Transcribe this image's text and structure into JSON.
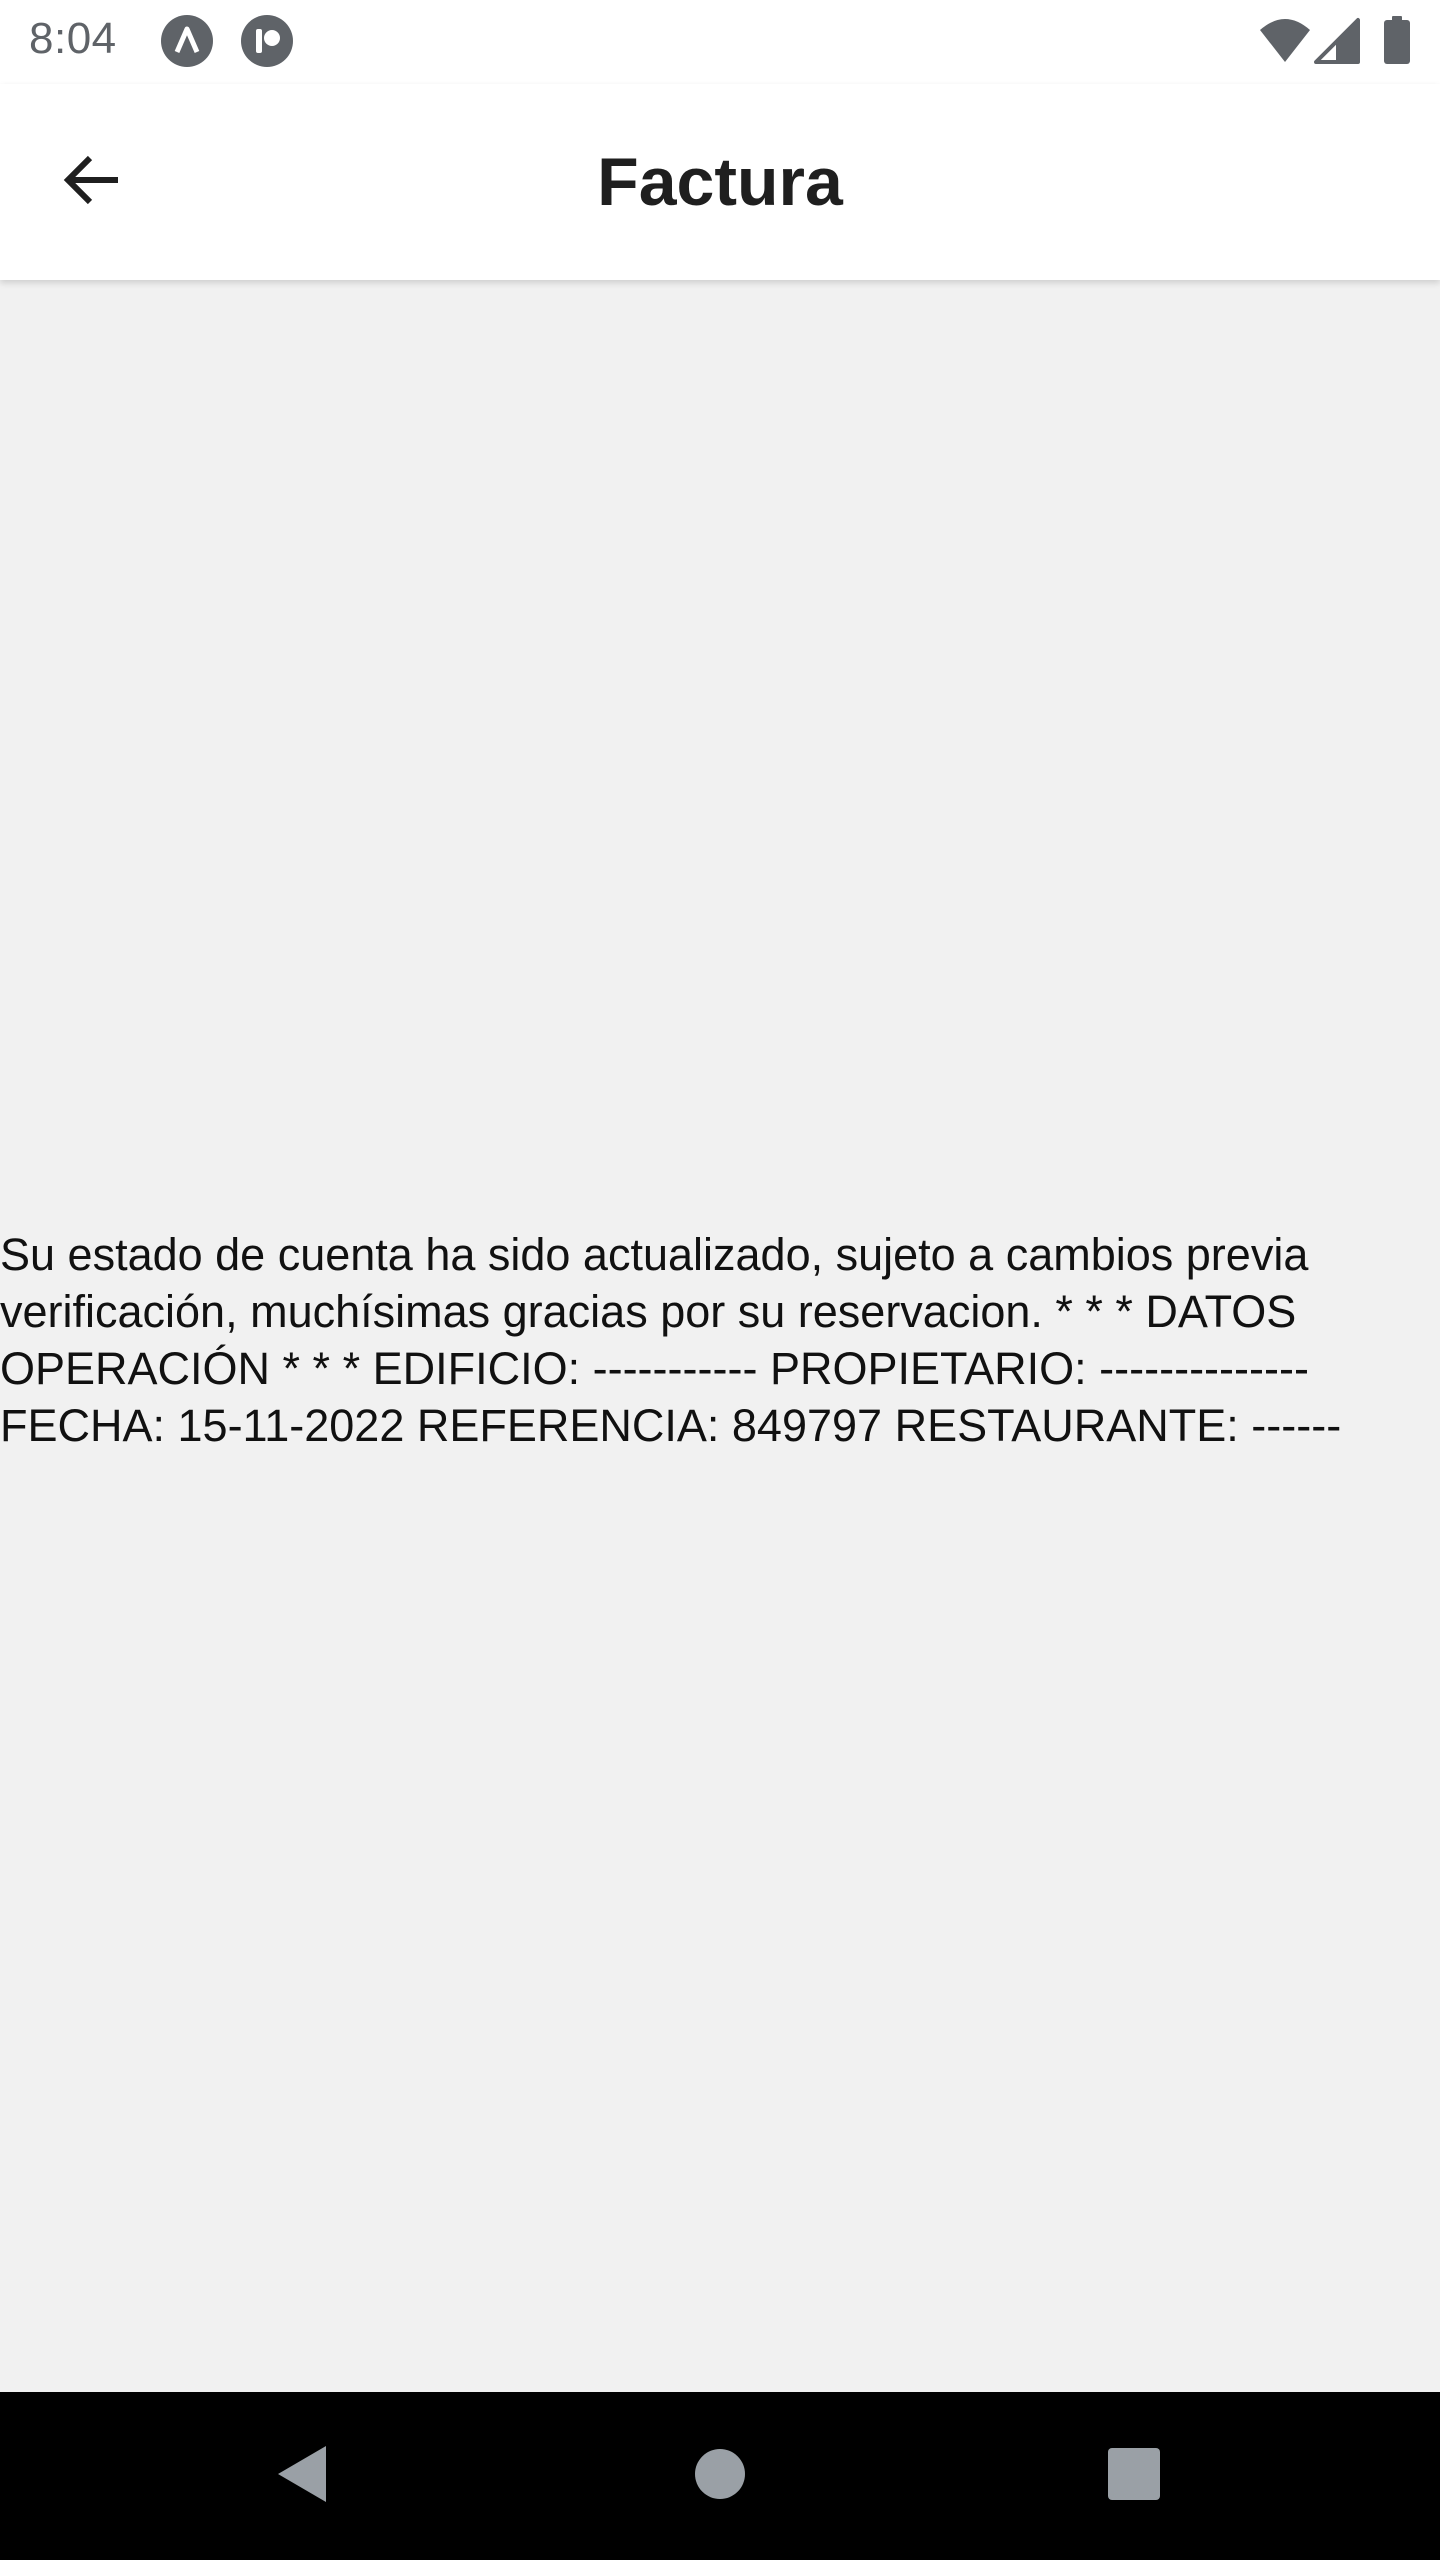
{
  "status_bar": {
    "time": "8:04",
    "notification_icons": [
      "a-letter-icon",
      "p-letter-icon"
    ],
    "right_icons": [
      "wifi-icon",
      "signal-icon",
      "battery-icon"
    ]
  },
  "app_bar": {
    "title": "Factura",
    "back_icon": "arrow-back-icon"
  },
  "content": {
    "message": "Su estado de cuenta ha sido actualizado, sujeto a cambios previa\nverificación, muchísimas gracias por su reservacion. * * * DATOS\nOPERACIÓN * * * EDIFICIO: ----------- PROPIETARIO: --------------\nFECHA: 15-11-2022 REFERENCIA: 849797 RESTAURANTE: ------"
  },
  "nav_bar": {
    "buttons": [
      "back-triangle-icon",
      "home-circle-icon",
      "recents-square-icon"
    ]
  },
  "colors": {
    "background": "#f1f1f1",
    "app_bar": "#ffffff",
    "nav_bar": "#000000",
    "status_text": "#5f6368"
  }
}
